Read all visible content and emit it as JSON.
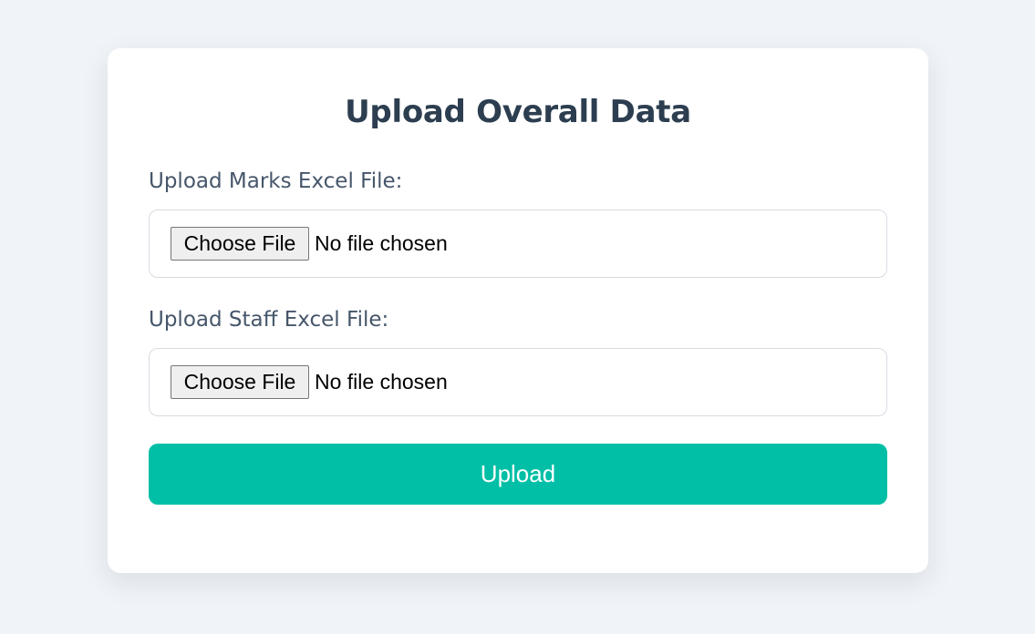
{
  "form": {
    "title": "Upload Overall Data",
    "marks": {
      "label": "Upload Marks Excel File:",
      "button_label": "Choose File",
      "status": "No file chosen"
    },
    "staff": {
      "label": "Upload Staff Excel File:",
      "button_label": "Choose File",
      "status": "No file chosen"
    },
    "submit_label": "Upload"
  },
  "colors": {
    "background": "#f0f3f7",
    "card": "#ffffff",
    "title": "#2c3e50",
    "label": "#46566a",
    "accent": "#00bfa6"
  }
}
